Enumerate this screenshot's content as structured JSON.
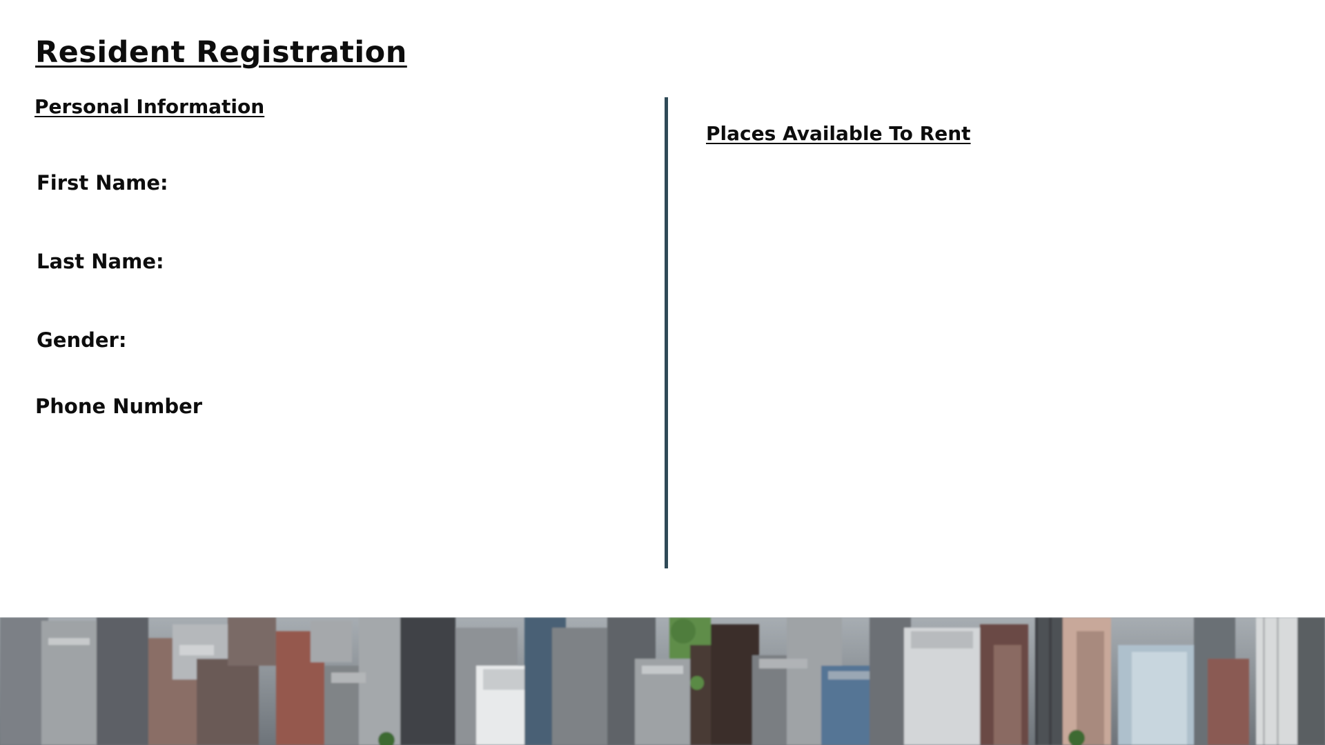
{
  "page": {
    "title": "Resident Registration"
  },
  "personal_info": {
    "heading": "Personal Information",
    "fields": [
      {
        "label": "First Name:"
      },
      {
        "label": "Last Name:"
      },
      {
        "label": "Gender:"
      },
      {
        "label": "Phone Number"
      }
    ]
  },
  "rentals": {
    "heading": "Places Available To Rent"
  },
  "colors": {
    "divider": "#2f4a57",
    "text": "#0d0d0d",
    "background": "#ffffff"
  },
  "banner": {
    "image": "city-skyline-aerial-photo"
  }
}
